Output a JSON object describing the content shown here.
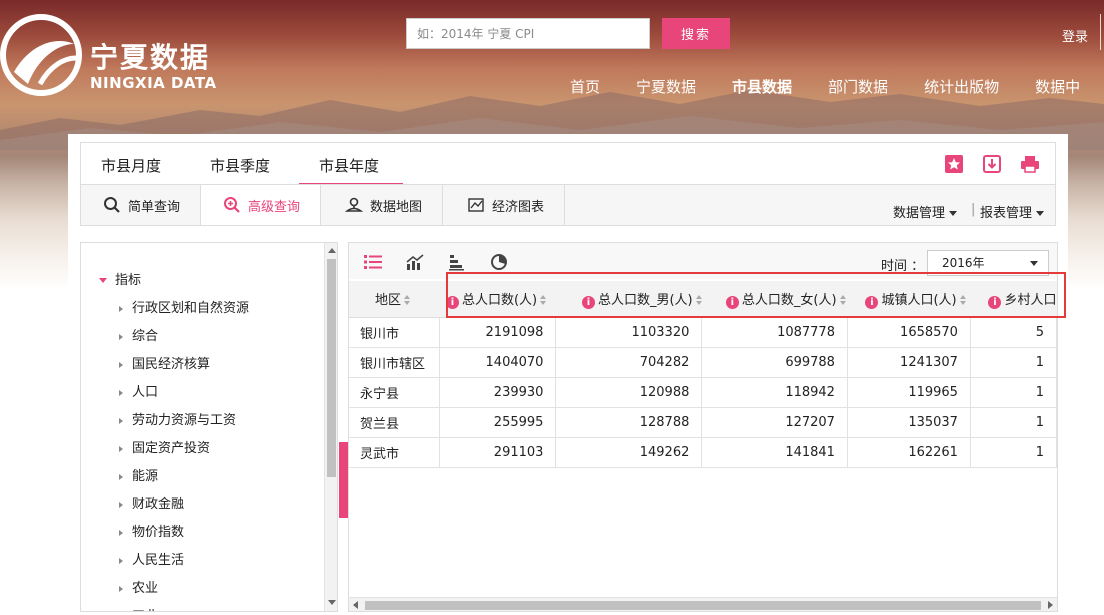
{
  "header": {
    "logo_cn": "宁夏数据",
    "logo_en": "NINGXIA DATA",
    "search_placeholder": "如：2014年 宁夏 CPI",
    "search_button": "搜索",
    "login": "登录",
    "nav": [
      {
        "label": "首页"
      },
      {
        "label": "宁夏数据"
      },
      {
        "label": "市县数据",
        "active": true
      },
      {
        "label": "部门数据"
      },
      {
        "label": "统计出版物"
      },
      {
        "label": "数据中"
      }
    ]
  },
  "tabs": [
    {
      "label": "市县月度"
    },
    {
      "label": "市县季度"
    },
    {
      "label": "市县年度",
      "active": true
    }
  ],
  "tab_icons": [
    "star-icon",
    "download-icon",
    "print-icon"
  ],
  "toolbar": {
    "buttons": [
      {
        "label": "简单查询",
        "icon": "search-icon"
      },
      {
        "label": "高级查询",
        "icon": "zoom-plus-icon",
        "active": true
      },
      {
        "label": "数据地图",
        "icon": "map-pin-icon"
      },
      {
        "label": "经济图表",
        "icon": "chart-icon"
      }
    ],
    "data_mgmt": "数据管理",
    "report_mgmt": "报表管理",
    "separator": "|"
  },
  "tree": {
    "root": "指标",
    "items": [
      "行政区划和自然资源",
      "综合",
      "国民经济核算",
      "人口",
      "劳动力资源与工资",
      "固定资产投资",
      "能源",
      "财政金融",
      "物价指数",
      "人民生活",
      "农业",
      "工业"
    ]
  },
  "grid": {
    "time_label": "时间 ：",
    "year": "2016年",
    "view_icons": [
      "list-icon",
      "line-chart-icon",
      "bar-chart-icon",
      "pie-chart-icon"
    ],
    "columns": [
      "地区",
      "总人口数(人)",
      "总人口数_男(人)",
      "总人口数_女(人)",
      "城镇人口(人)",
      "乡村人口"
    ],
    "rows": [
      {
        "name": "银川市",
        "values": [
          "2191098",
          "1103320",
          "1087778",
          "1658570",
          "5"
        ]
      },
      {
        "name": "银川市辖区",
        "values": [
          "1404070",
          "704282",
          "699788",
          "1241307",
          "1"
        ]
      },
      {
        "name": "永宁县",
        "values": [
          "239930",
          "120988",
          "118942",
          "119965",
          "1"
        ]
      },
      {
        "name": "贺兰县",
        "values": [
          "255995",
          "128788",
          "127207",
          "135037",
          "1"
        ]
      },
      {
        "name": "灵武市",
        "values": [
          "291103",
          "149262",
          "141841",
          "162261",
          "1"
        ]
      }
    ]
  },
  "colors": {
    "accent": "#e8457a",
    "highlight": "#e53a3a"
  }
}
